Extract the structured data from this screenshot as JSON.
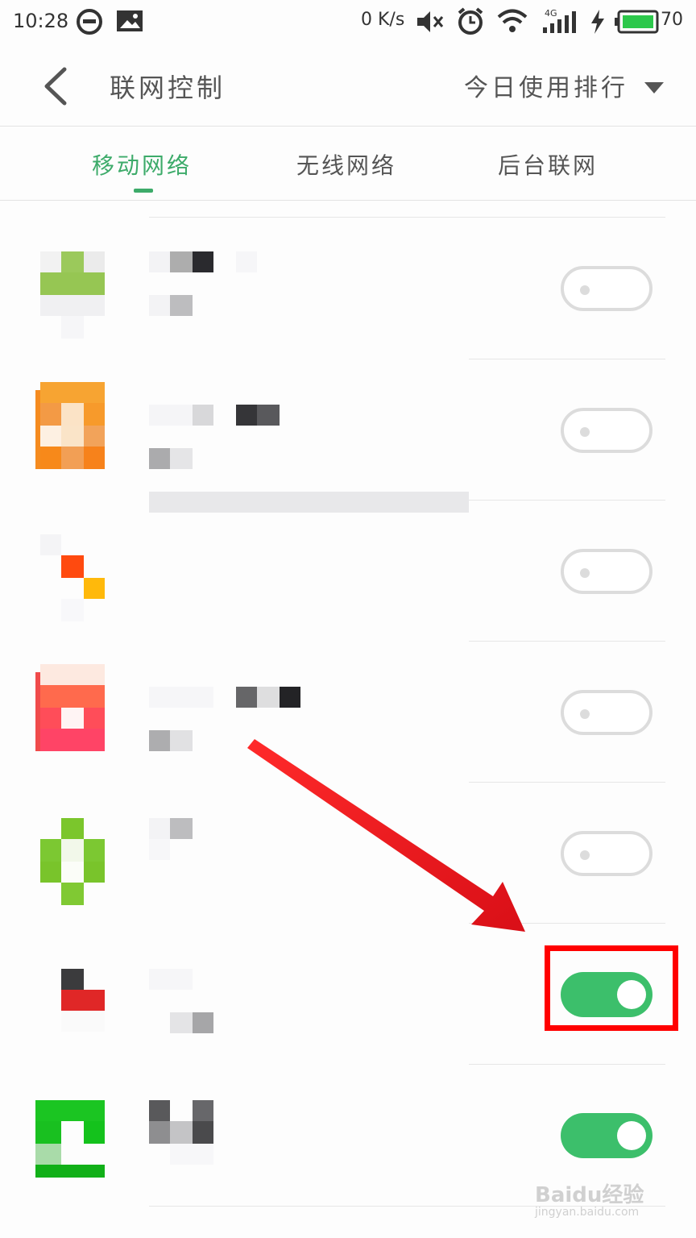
{
  "status_bar": {
    "time": "10:28",
    "net_speed": "0 K/s",
    "network_type": "4G",
    "battery": "70",
    "icons": [
      "hangouts-icon",
      "image-icon",
      "mute-icon",
      "alarm-icon",
      "wifi-icon",
      "signal-icon",
      "charging-icon",
      "battery-icon"
    ]
  },
  "header": {
    "back_icon": "chevron-left-icon",
    "title": "联网控制",
    "sort_label": "今日使用排行",
    "sort_icon": "triangle-down-icon"
  },
  "tabs": [
    {
      "label": "移动网络",
      "active": true
    },
    {
      "label": "无线网络",
      "active": false
    },
    {
      "label": "后台联网",
      "active": false
    }
  ],
  "apps": [
    {
      "enabled": false
    },
    {
      "enabled": false
    },
    {
      "enabled": false
    },
    {
      "enabled": false
    },
    {
      "enabled": false
    },
    {
      "enabled": true
    },
    {
      "enabled": true
    }
  ],
  "annotation": {
    "arrow_color": "#e8141b",
    "box_color": "#ff0000"
  },
  "watermark": {
    "text": "Baidu经验",
    "sub": "jingyan.baidu.com"
  },
  "colors": {
    "accent": "#3dab6a",
    "toggle_on": "#3cbf6b",
    "toggle_off": "#dcdcdc"
  }
}
